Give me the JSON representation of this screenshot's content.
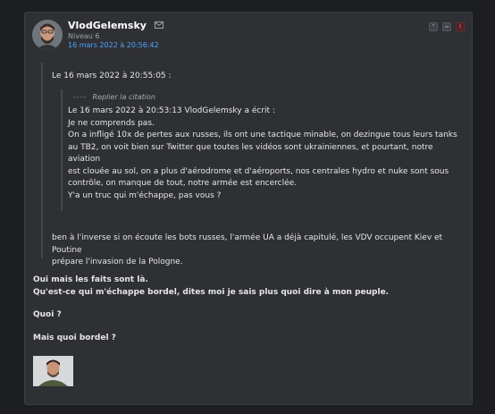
{
  "post": {
    "author": {
      "username": "VlodGelemsky",
      "level": "Niveau 6"
    },
    "date": "16 mars 2022 à 20:56:42",
    "actions": [
      {
        "icon": "quote-icon",
        "glyph": "”"
      },
      {
        "icon": "moderate-icon",
        "glyph": "≈"
      },
      {
        "icon": "report-icon",
        "glyph": "!"
      }
    ]
  },
  "quote": {
    "header": "Le 16 mars 2022 à 20:55:05 :",
    "reply_link": "Replier la citation",
    "reply_dots": "----",
    "inner_lines": [
      "Le 16 mars 2022 à 20:53:13 VlodGelemsky a écrit :",
      "Je ne comprends pas.",
      "On a infligé 10x de pertes aux russes, ils ont une tactique minable, on dezingue tous leurs tanks",
      "au TB2, on voit bien sur Twitter que toutes les vidéos sont ukrainiennes, et pourtant, notre aviation",
      "est clouée au sol, on a plus d'aérodrome et d'aéroports, nos centrales hydro et nuke sont sous",
      "contrôle, on manque de tout, notre armée est encerclée.",
      "Y'a un truc qui m'échappe, pas vous ?"
    ],
    "outer_lines": [
      "ben à l'inverse si on écoute les bots russes, l'armée UA a déjà capitulé, les VDV occupent Kiev et Poutine",
      "prépare l'invasion de la Pologne."
    ]
  },
  "body": {
    "line1": "Oui mais les faits sont là.",
    "line2": "Qu'est-ce qui m'échappe bordel, dites moi je sais plus quoi dire à mon peuple.",
    "line3": "Quoi ?",
    "line4": "Mais quoi bordel ?"
  },
  "colors": {
    "link": "#4fa3ff",
    "background": "#1c1e21",
    "card": "#2e3033",
    "report": "#e0444e"
  }
}
